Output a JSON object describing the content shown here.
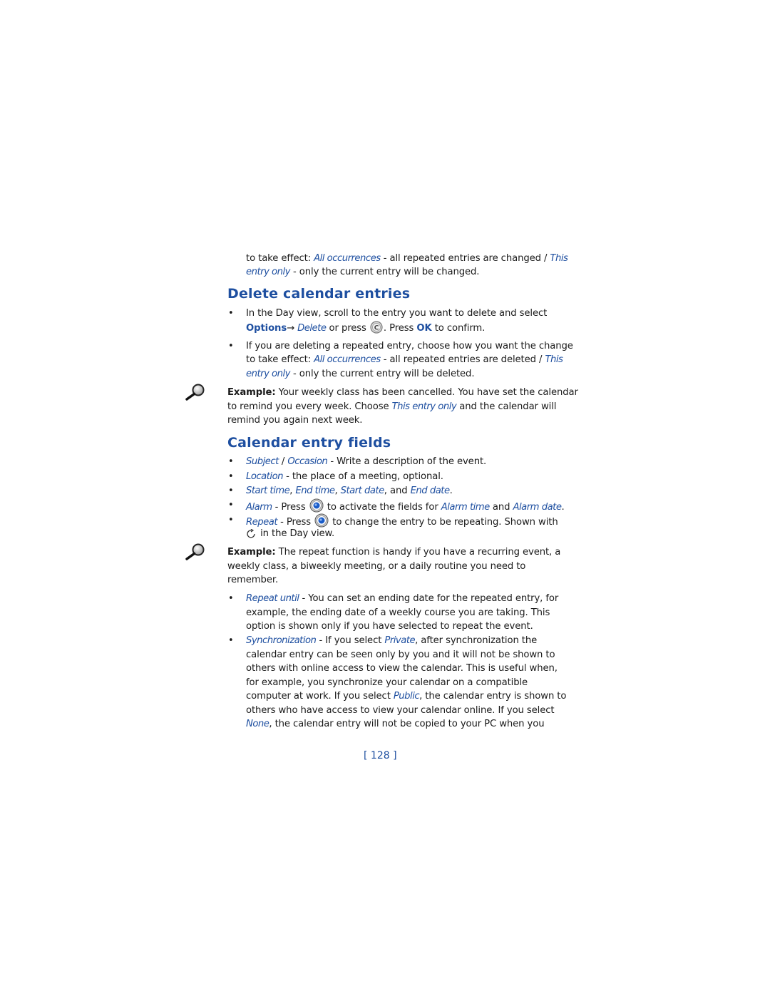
{
  "intro": {
    "line1_prefix": "to take effect: ",
    "line1_link": "All occurrences",
    "line1_mid": " - all repeated entries are changed / ",
    "line1_link2": "This",
    "line2_link": "entry only",
    "line2_rest": " - only the current entry will be changed."
  },
  "delete_section": {
    "heading": "Delete calendar entries",
    "bullet1": {
      "line1": "In the Day view, scroll to the entry you want to delete and select",
      "options": "Options",
      "arrow": "→ ",
      "delete": "Delete",
      "or_press": " or press ",
      "press": ". Press ",
      "ok": "OK",
      "confirm": " to confirm."
    },
    "bullet2": {
      "line1": "If you are deleting a repeated entry, choose how you want the change",
      "line2_prefix": "to take effect: ",
      "line2_link": "All occurrences",
      "line2_mid": " - all repeated entries are deleted / ",
      "line2_link2": "This",
      "line3_link": "entry only",
      "line3_rest": " - only the current entry will be deleted."
    },
    "example": {
      "label": "Example:",
      "line1": " Your weekly class has been cancelled. You have set the calendar",
      "line2_prefix": "to remind you every week. Choose ",
      "line2_link": "This entry only",
      "line2_rest": " and the calendar will",
      "line3": "remind you again next week."
    }
  },
  "fields_section": {
    "heading": "Calendar entry fields",
    "subject": {
      "link1": "Subject",
      "sep": " / ",
      "link2": "Occasion",
      "rest": " - Write a description of the event."
    },
    "location": {
      "link": "Location",
      "rest": " - the place of a meeting, optional."
    },
    "times": {
      "l1": "Start time",
      "c1": ", ",
      "l2": "End time",
      "c2": ", ",
      "l3": "Start date",
      "c3": ", and ",
      "l4": "End date",
      "end": "."
    },
    "alarm": {
      "link": "Alarm",
      "press": " - Press ",
      "mid": " to activate the fields for ",
      "l2": "Alarm time",
      "and": " and ",
      "l3": "Alarm date",
      "end": "."
    },
    "repeat": {
      "link": "Repeat",
      "press": " - Press ",
      "rest": " to change the entry to be repeating. Shown with",
      "line2": " in the Day view."
    },
    "example": {
      "label": "Example:",
      "line1": " The repeat function is handy if you have a recurring event, a",
      "line2": "weekly class, a biweekly meeting, or a daily routine you need to",
      "line3": "remember."
    },
    "repeat_until": {
      "link": "Repeat until",
      "line1": " - You can set an ending date for the repeated entry, for",
      "line2": "example, the ending date of a weekly course you are taking. This",
      "line3": "option is shown only if you have selected to repeat the event."
    },
    "sync": {
      "link": "Synchronization",
      "mid1": " - If you select ",
      "private": "Private",
      "line1_rest": ", after synchronization the",
      "line2": "calendar entry can be seen only by you and it will not be shown to",
      "line3": "others with online access to view the calendar. This is useful when,",
      "line4": "for example, you synchronize your calendar on a compatible",
      "line5_prefix": "computer at work. If you select ",
      "public": "Public",
      "line5_rest": ", the calendar entry is shown to",
      "line6": "others who have access to view your calendar online. If you select",
      "none": "None",
      "line7_rest": ", the calendar entry will not be copied to your PC when you"
    }
  },
  "footer": {
    "page_number": "[ 128 ]"
  },
  "icons": {
    "bullet": "•"
  }
}
